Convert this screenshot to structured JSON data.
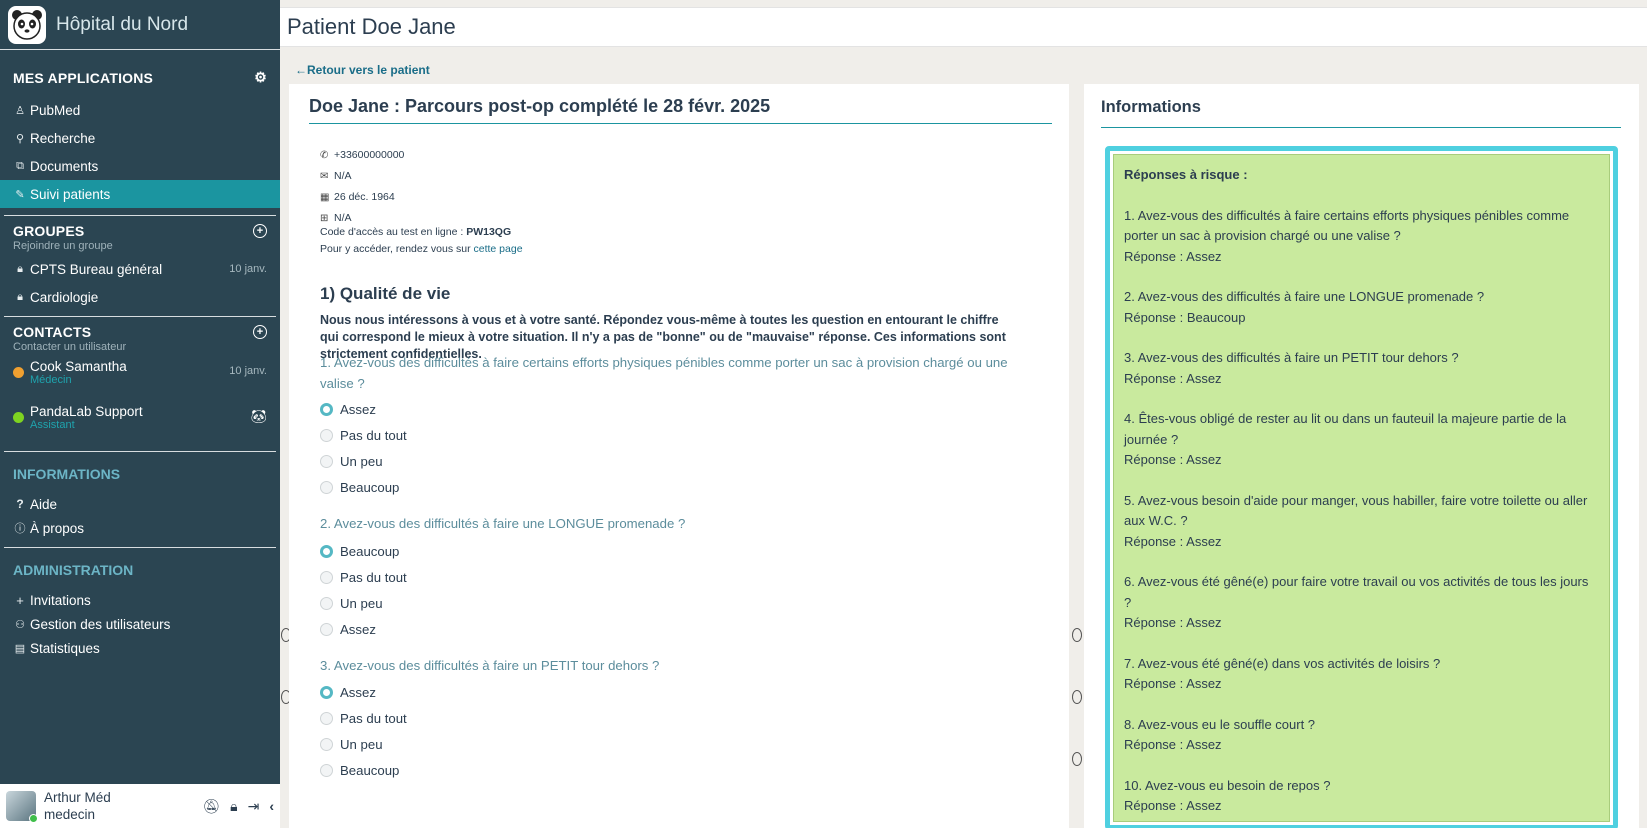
{
  "app": {
    "name": "Hôpital du Nord"
  },
  "sidebar": {
    "apps_title": "MES APPLICATIONS",
    "apps": [
      {
        "label": "PubMed",
        "icon": "person-icon"
      },
      {
        "label": "Recherche",
        "icon": "search-icon"
      },
      {
        "label": "Documents",
        "icon": "paperclip-icon"
      },
      {
        "label": "Suivi patients",
        "icon": "edit-icon",
        "active": true
      }
    ],
    "groups_title": "GROUPES",
    "groups_sub": "Rejoindre un groupe",
    "groups": [
      {
        "label": "CPTS Bureau général",
        "date": "10 janv."
      },
      {
        "label": "Cardiologie",
        "date": ""
      }
    ],
    "contacts_title": "CONTACTS",
    "contacts_sub": "Contacter un utilisateur",
    "contacts": [
      {
        "name": "Cook Samantha",
        "role": "Médecin",
        "date": "10 janv.",
        "status_color": "#f0a030"
      },
      {
        "name": "PandaLab Support",
        "role": "Assistant",
        "date": "",
        "status_color": "#7ed321"
      }
    ],
    "informations_title": "INFORMATIONS",
    "informations": [
      {
        "label": "Aide",
        "icon": "question-icon"
      },
      {
        "label": "À propos",
        "icon": "info-icon"
      }
    ],
    "admin_title": "ADMINISTRATION",
    "admin": [
      {
        "label": "Invitations",
        "icon": "plus-icon"
      },
      {
        "label": "Gestion des utilisateurs",
        "icon": "users-icon"
      },
      {
        "label": "Statistiques",
        "icon": "stats-icon"
      }
    ],
    "user": {
      "name": "Arthur Méd",
      "role": "medecin"
    }
  },
  "header": {
    "title": "Patient Doe Jane"
  },
  "back_link": "Retour vers le patient",
  "main": {
    "title": "Doe Jane : Parcours post-op complété le 28 févr. 2025",
    "phone": "+33600000000",
    "email": "N/A",
    "birthdate": "26 déc. 1964",
    "other": "N/A",
    "access_label": "Code d'accès au test en ligne : ",
    "access_code": "PW13QG",
    "access_hint": "Pour y accéder, rendez vous sur ",
    "access_link": "cette page",
    "section_title": "1) Qualité de vie",
    "intro": "Nous nous intéressons à vous et à votre santé. Répondez vous-même à toutes les question en entourant le chiffre qui correspond le mieux à votre situation. Il n'y a pas de \"bonne\" ou de \"mauvaise\" réponse. Ces informations sont strictement confidentielles.",
    "questions": [
      {
        "text": "1. Avez-vous des difficultés à faire certains efforts physiques pénibles comme porter un sac à provision chargé ou une valise ?",
        "options": [
          "Assez",
          "Pas du tout",
          "Un peu",
          "Beaucoup"
        ],
        "selected": 0
      },
      {
        "text": "2. Avez-vous des difficultés à faire une LONGUE promenade ?",
        "options": [
          "Beaucoup",
          "Pas du tout",
          "Un peu",
          "Assez"
        ],
        "selected": 0
      },
      {
        "text": "3. Avez-vous des difficultés à faire un PETIT tour dehors ?",
        "options": [
          "Assez",
          "Pas du tout",
          "Un peu",
          "Beaucoup"
        ],
        "selected": 0
      }
    ]
  },
  "info": {
    "title": "Informations",
    "risk_title": "Réponses à risque :",
    "items": [
      {
        "q": "1. Avez-vous des difficultés à faire certains efforts physiques pénibles comme porter un sac à provision chargé ou une valise ?",
        "a": "Réponse : Assez"
      },
      {
        "q": "2. Avez-vous des difficultés à faire une LONGUE promenade ?",
        "a": "Réponse : Beaucoup"
      },
      {
        "q": "3. Avez-vous des difficultés à faire un PETIT tour dehors ?",
        "a": "Réponse : Assez"
      },
      {
        "q": "4. Êtes-vous obligé de rester au lit ou dans un fauteuil la majeure partie de la journée ?",
        "a": "Réponse : Assez"
      },
      {
        "q": "5. Avez-vous besoin d'aide pour manger, vous habiller, faire votre toilette ou aller aux W.C. ?",
        "a": "Réponse : Assez"
      },
      {
        "q": "6. Avez-vous été gêné(e) pour faire votre travail ou vos activités de tous les jours ?",
        "a": "Réponse : Assez"
      },
      {
        "q": "7. Avez-vous été gêné(e) dans vos activités de loisirs ?",
        "a": "Réponse : Assez"
      },
      {
        "q": "8. Avez-vous eu le souffle court ?",
        "a": "Réponse : Assez"
      },
      {
        "q": "10. Avez-vous eu besoin de repos ?",
        "a": "Réponse : Assez"
      }
    ]
  }
}
